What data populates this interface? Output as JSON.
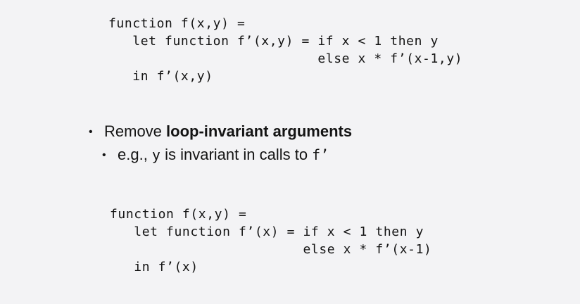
{
  "code_before": {
    "line1": "function f(x,y) =",
    "line2": "   let function f’(x,y) = if x < 1 then y",
    "line3": "                          else x * f’(x-1,y)",
    "line4": "   in f’(x,y)"
  },
  "bullet_main": {
    "text": "Remove ",
    "emphasis": "loop-invariant arguments"
  },
  "bullet_sub": {
    "prefix": "e.g., ",
    "var": "y",
    "middle": " is invariant in calls to ",
    "fn": "f’"
  },
  "code_after": {
    "line1": "function f(x,y) =",
    "line2": "   let function f’(x) = if x < 1 then y",
    "line3": "                        else x * f’(x-1)",
    "line4": "   in f’(x)"
  }
}
